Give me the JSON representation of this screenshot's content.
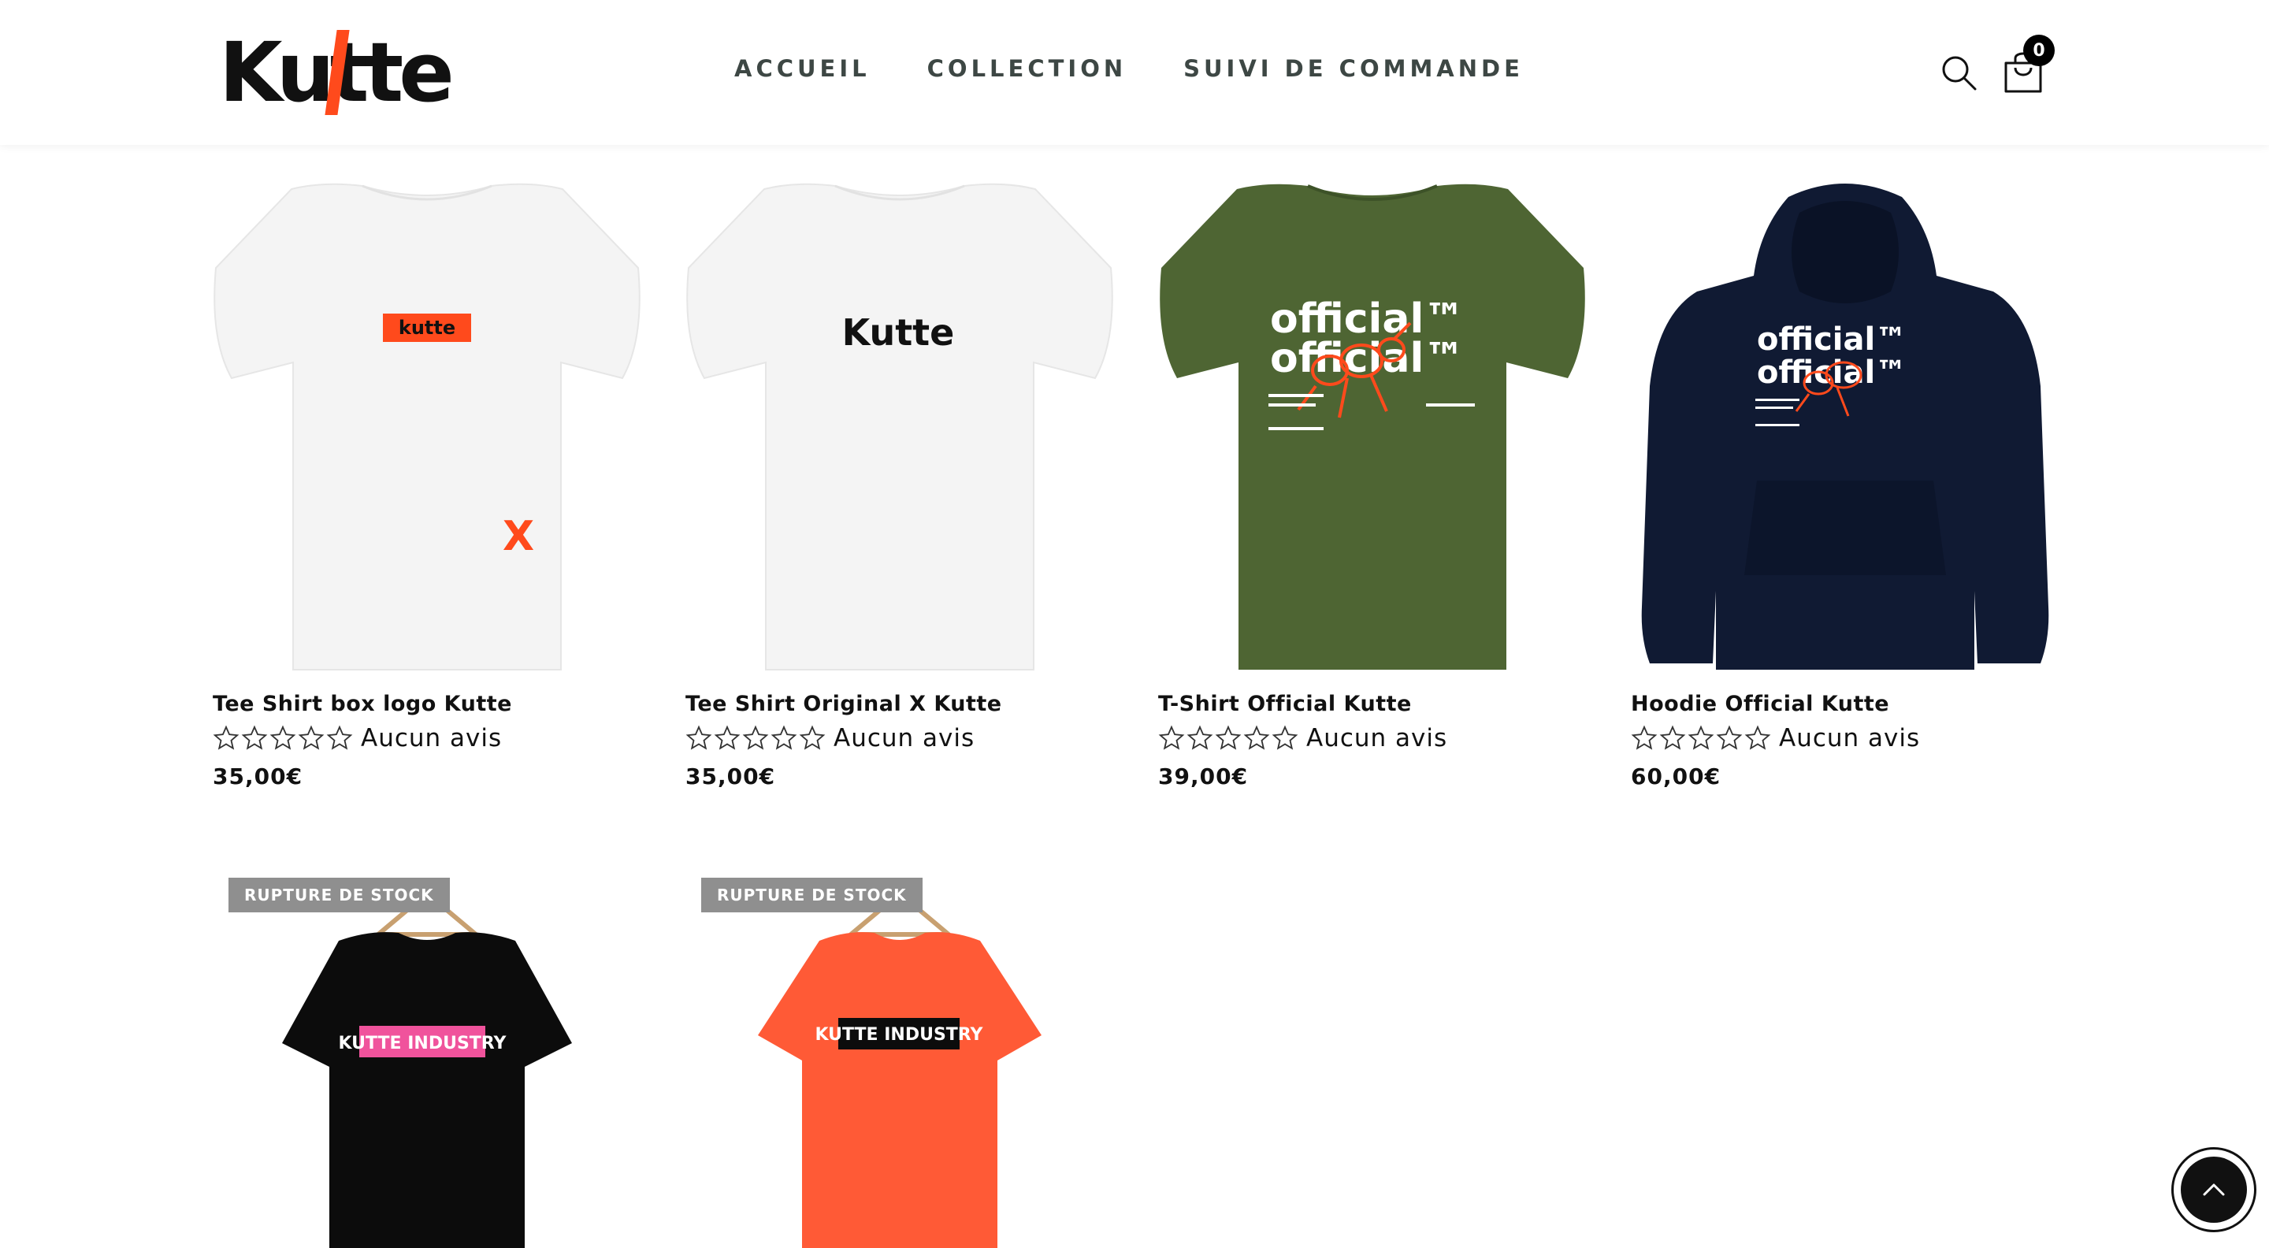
{
  "brand": {
    "logo_text": "Kutte",
    "accent": "#ff4a1c"
  },
  "nav": {
    "items": [
      {
        "label": "ACCUEIL"
      },
      {
        "label": "COLLECTION"
      },
      {
        "label": "SUIVI DE COMMANDE"
      }
    ]
  },
  "header": {
    "search_icon": "search-icon",
    "cart_icon": "shopping-bag-icon",
    "cart_count": "0"
  },
  "products": [
    {
      "title": "Tee Shirt box logo Kutte",
      "rating_label": "Aucun avis",
      "rating": 0,
      "price": "35,00€",
      "print_text": "kutte",
      "garment_color": "#f4f4f4"
    },
    {
      "title": "Tee Shirt Original X Kutte",
      "rating_label": "Aucun avis",
      "rating": 0,
      "price": "35,00€",
      "print_text": "Kutte",
      "garment_color": "#f4f4f4"
    },
    {
      "title": "T-Shirt Official Kutte",
      "rating_label": "Aucun avis",
      "rating": 0,
      "price": "39,00€",
      "print_text": "official™",
      "garment_color": "#4e6533"
    },
    {
      "title": "Hoodie Official Kutte",
      "rating_label": "Aucun avis",
      "rating": 0,
      "price": "60,00€",
      "print_text": "official™",
      "garment_color": "#101a33"
    },
    {
      "badge": "RUPTURE DE STOCK",
      "print_text": "KUTTE INDUSTRY",
      "garment_color": "#0c0c0c",
      "print_bg": "#f0539c"
    },
    {
      "badge": "RUPTURE DE STOCK",
      "print_text": "KUTTE INDUSTRY",
      "garment_color": "#ff5a36",
      "print_bg": "#0c0c0c"
    }
  ],
  "back_to_top_icon": "chevron-up-icon"
}
